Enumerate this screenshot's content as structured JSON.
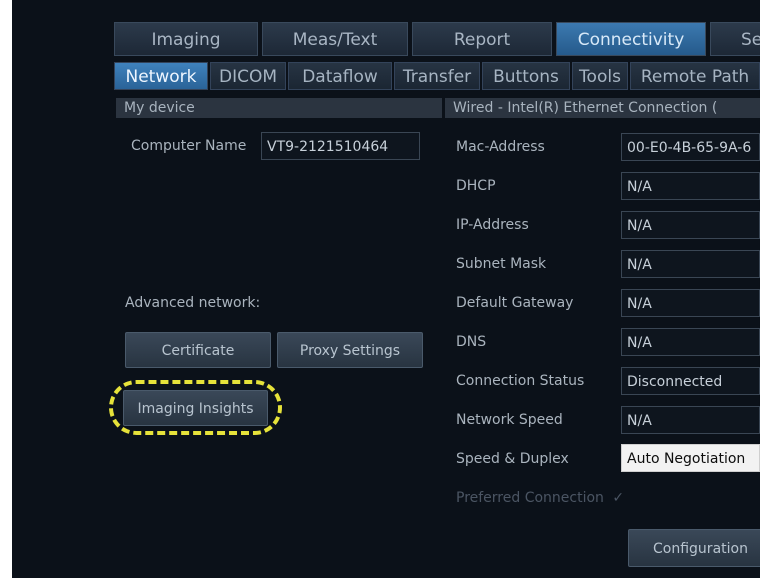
{
  "top_tabs": [
    "Imaging",
    "Meas/Text",
    "Report",
    "Connectivity",
    "Se"
  ],
  "sub_tabs": [
    "Network",
    "DICOM",
    "Dataflow",
    "Transfer",
    "Buttons",
    "Tools",
    "Remote Path"
  ],
  "my_device": {
    "header": "My device",
    "computer_name_label": "Computer Name",
    "computer_name_value": "VT9-2121510464",
    "advanced_label": "Advanced network:",
    "certificate_button": "Certificate",
    "proxy_button": "Proxy Settings",
    "imaging_insights_button": "Imaging Insights"
  },
  "wired": {
    "header": "Wired - Intel(R) Ethernet Connection (",
    "rows": [
      {
        "label": "Mac-Address",
        "value": "00-E0-4B-65-9A-6"
      },
      {
        "label": "DHCP",
        "value": "N/A"
      },
      {
        "label": "IP-Address",
        "value": "N/A"
      },
      {
        "label": "Subnet Mask",
        "value": "N/A"
      },
      {
        "label": "Default Gateway",
        "value": "N/A"
      },
      {
        "label": "DNS",
        "value": "N/A"
      },
      {
        "label": "Connection Status",
        "value": "Disconnected"
      },
      {
        "label": "Network Speed",
        "value": "N/A"
      },
      {
        "label": "Speed & Duplex",
        "value": "Auto Negotiation"
      }
    ],
    "preferred_label": "Preferred Connection",
    "preferred_check": "✓",
    "configuration_button": "Configuration"
  }
}
